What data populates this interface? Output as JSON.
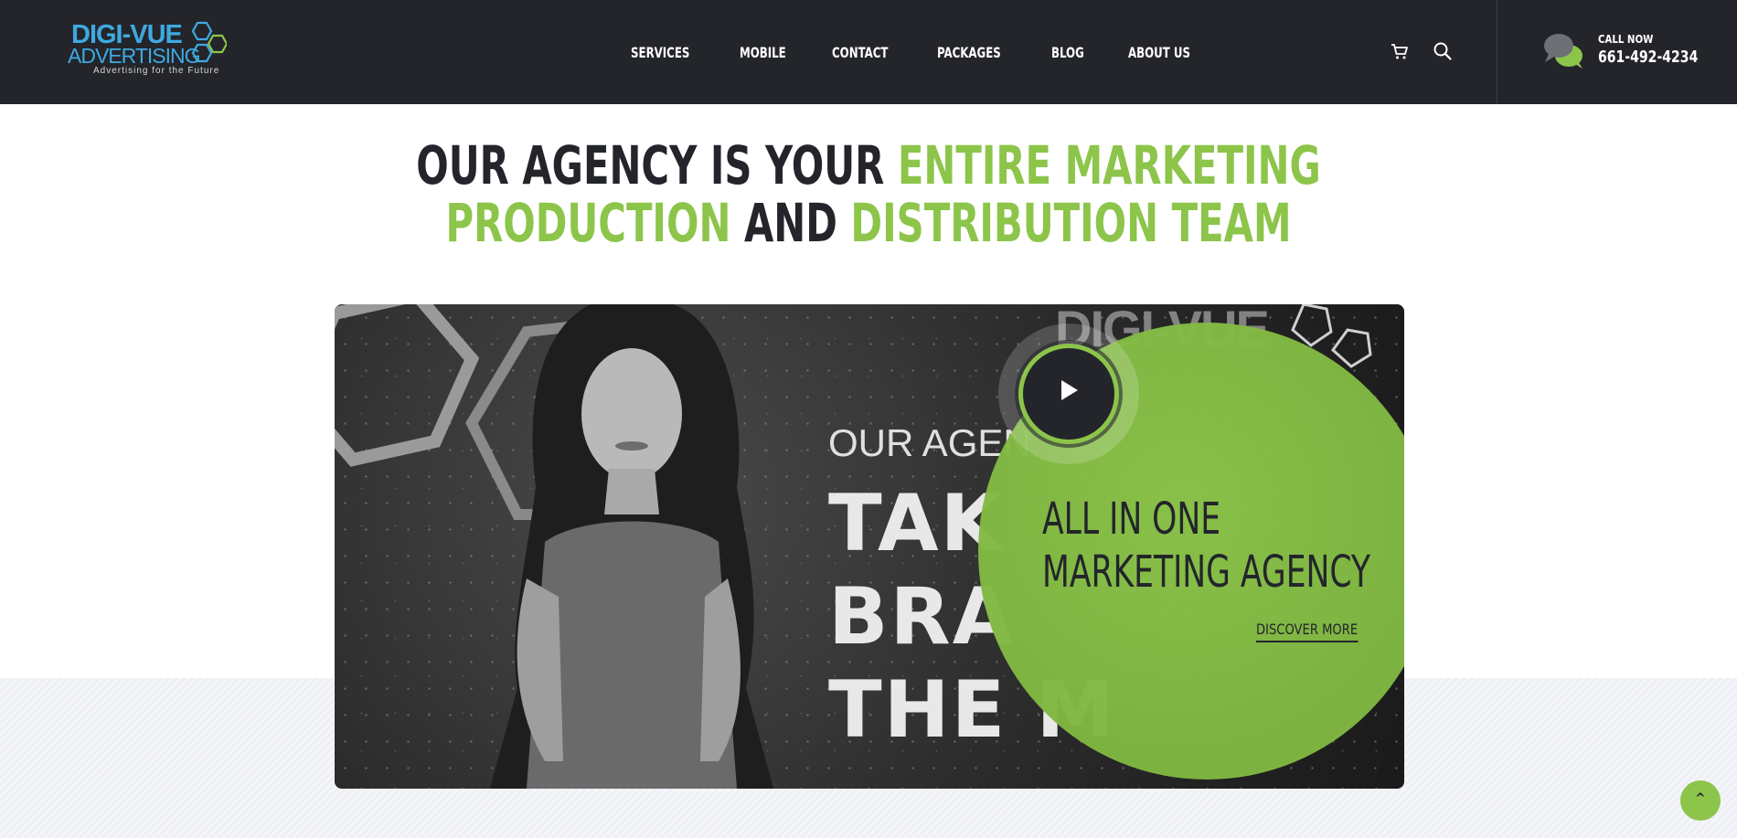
{
  "header": {
    "logo": {
      "line1": "DIGI-VUE",
      "line2": "ADVERTISING",
      "tagline": "Advertising for the Future"
    },
    "nav": [
      {
        "label": "SERVICES"
      },
      {
        "label": "MOBILE"
      },
      {
        "label": "CONTACT"
      },
      {
        "label": "PACKAGES"
      },
      {
        "label": "BLOG"
      },
      {
        "label": "ABOUT US"
      }
    ],
    "icons": [
      "cart-icon",
      "search-icon"
    ],
    "call": {
      "label": "CALL NOW",
      "number": "661-492-4234"
    }
  },
  "hero": {
    "headline": {
      "part1": "OUR AGENCY IS YOUR ",
      "part2": "ENTIRE MARKETING",
      "part3": "PRODUCTION",
      "part4": " AND ",
      "part5": "DISTRIBUTION TEAM"
    }
  },
  "video": {
    "overlay_title_line1": "ALL IN ONE",
    "overlay_title_line2": "MARKETING AGENCY",
    "discover_label": "DISCOVER MORE",
    "background_text": {
      "watermark": "DIGI-VUE",
      "small": "OUR AGEN",
      "big1": "TAK",
      "big2": "BRA",
      "big3": "THE M"
    }
  },
  "colors": {
    "accent": "#8cc54a",
    "dark": "#23252b",
    "logo_blue": "#3fa9e0"
  },
  "back_to_top_icon": "chevron-up-icon"
}
